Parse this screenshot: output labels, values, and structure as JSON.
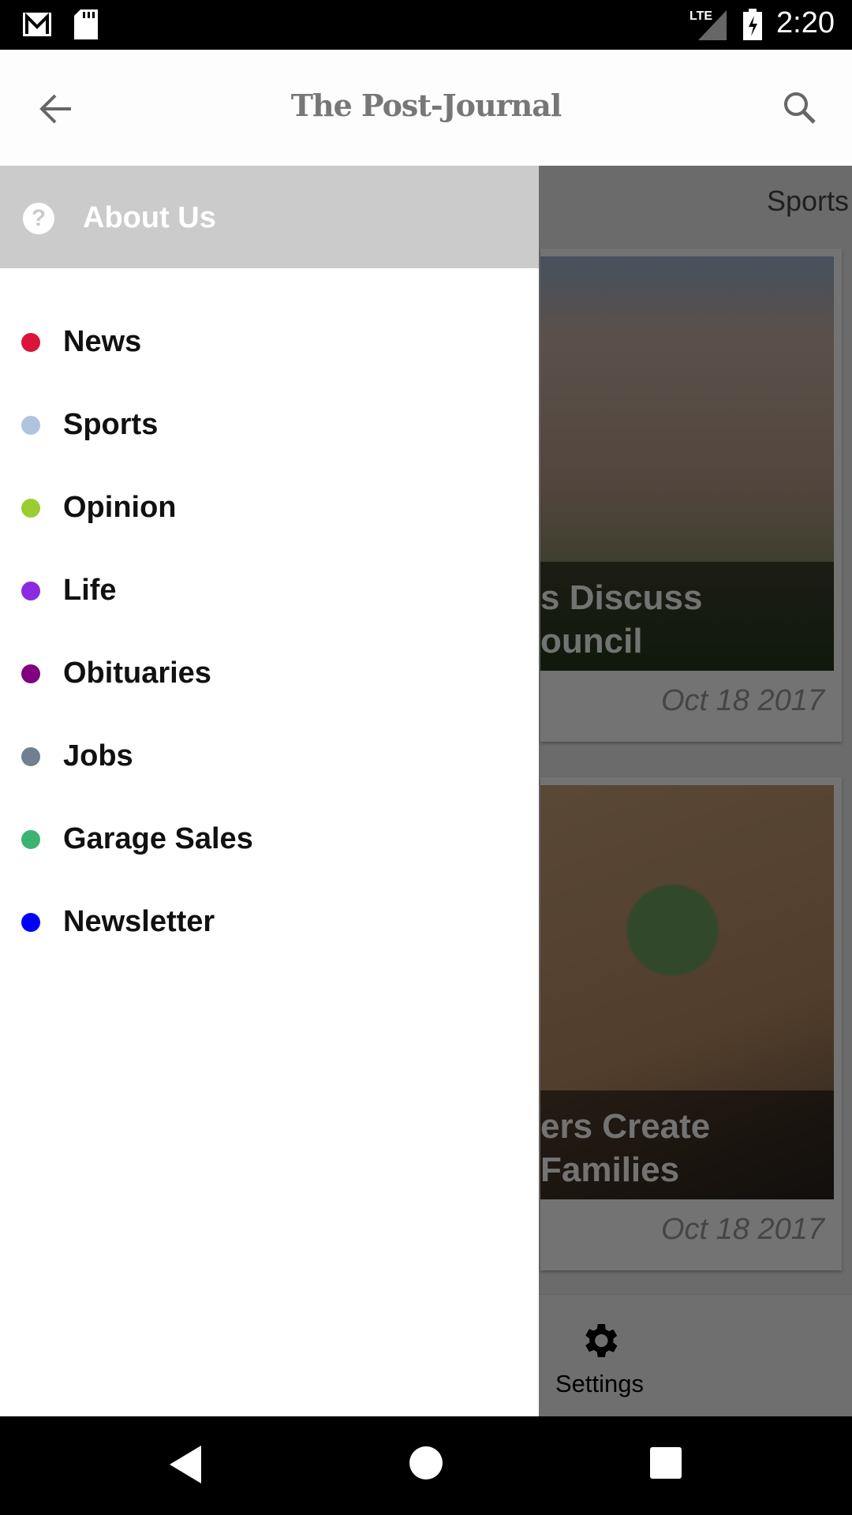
{
  "status_bar": {
    "time": "2:20",
    "network": "LTE",
    "icons": [
      "gmail-icon",
      "sd-card-icon",
      "signal-icon",
      "battery-charging-icon"
    ]
  },
  "app_bar": {
    "title": "The Post-Journal",
    "back_icon": "arrow-left-icon",
    "search_icon": "search-icon"
  },
  "content": {
    "active_tab": "Sports",
    "cards": [
      {
        "caption": "s Discuss\nouncil",
        "date": "Oct 18 2017"
      },
      {
        "caption": "ers Create\nFamilies",
        "date": "Oct 18 2017"
      }
    ],
    "bottom_bar": {
      "settings_label": "Settings",
      "settings_icon": "gear-icon"
    }
  },
  "drawer": {
    "header": {
      "label": "About Us",
      "icon": "help-circle-icon"
    },
    "items": [
      {
        "label": "News",
        "color": "#dc143c"
      },
      {
        "label": "Sports",
        "color": "#b0c4de"
      },
      {
        "label": "Opinion",
        "color": "#9acd32"
      },
      {
        "label": "Life",
        "color": "#8a2be2"
      },
      {
        "label": "Obituaries",
        "color": "#800080"
      },
      {
        "label": "Jobs",
        "color": "#708090"
      },
      {
        "label": "Garage Sales",
        "color": "#3cb371"
      },
      {
        "label": "Newsletter",
        "color": "#0000ff"
      }
    ]
  }
}
